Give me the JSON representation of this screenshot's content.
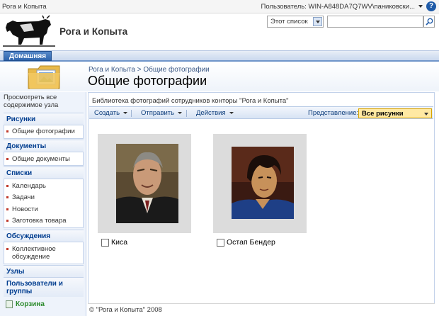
{
  "topbar": {
    "site_link": "Рога и Копыта",
    "user_label": "Пользователь: WIN-A848DA7Q7WV\\паниковски...",
    "help_icon": "help-icon"
  },
  "header": {
    "site_title": "Рога и Копыта",
    "search_scope": "Этот список",
    "search_value": ""
  },
  "nav": {
    "home_tab": "Домашняя"
  },
  "title_area": {
    "breadcrumb": "Рога и Копыта > Общие фотографии",
    "page_title": "Общие фотографии"
  },
  "leftnav": {
    "view_all": "Просмотреть все содержимое узла",
    "sections": [
      {
        "heading": "Рисунки",
        "items": [
          "Общие фотографии"
        ]
      },
      {
        "heading": "Документы",
        "items": [
          "Общие документы"
        ]
      },
      {
        "heading": "Списки",
        "items": [
          "Календарь",
          "Задачи",
          "Новости",
          "Заготовка товара"
        ]
      },
      {
        "heading": "Обсуждения",
        "items": [
          "Коллективное обсуждение"
        ]
      },
      {
        "heading": "Узлы",
        "items": []
      },
      {
        "heading": "Пользователи и группы",
        "items": []
      }
    ],
    "recycle_bin": "Корзина"
  },
  "main": {
    "description": "Библиотека фотографий сотрудников конторы \"Рога и Копыта\"",
    "toolbar": {
      "create": "Создать",
      "send": "Отправить",
      "actions": "Действия",
      "view_label": "Представление:",
      "view_value": "Все рисунки"
    },
    "photos": [
      {
        "caption": "Киса"
      },
      {
        "caption": "Остап Бендер"
      }
    ]
  },
  "footer": {
    "copyright": "© \"Рога и Копыта\" 2008"
  }
}
